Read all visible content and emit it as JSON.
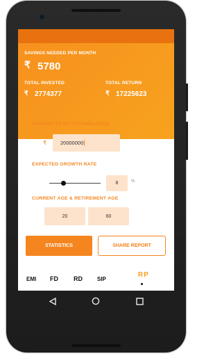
{
  "header": {
    "savings_label": "SAVINGS NEEDED PER MONTH",
    "rupee": "₹",
    "savings_value": "5780",
    "invested_label": "TOTAL INVESTED",
    "invested_value": "2774377",
    "return_label": "TOTAL RETURN",
    "return_value": "17225623"
  },
  "form": {
    "amount_label": "AMOUNT TO BE ACCUMULATED",
    "amount_rupee": "₹",
    "amount_value": "20000000",
    "growth_label": "EXPECTED GROWTH RATE",
    "growth_value": "8",
    "growth_unit": "%",
    "age_label": "CURRENT AGE & RETIREMENT AGE",
    "current_age": "20",
    "retirement_age": "60"
  },
  "actions": {
    "statistics_label": "STATISTICS",
    "share_label": "SHARE REPORT"
  },
  "tabs": {
    "items": [
      "EMI",
      "FD",
      "RD",
      "SIP"
    ],
    "active": "RP"
  },
  "growth_slider_level": 0.28,
  "colors": {
    "accent": "#f5851f",
    "header_bg": "#f7981e",
    "field_bg": "#fde3cc"
  }
}
